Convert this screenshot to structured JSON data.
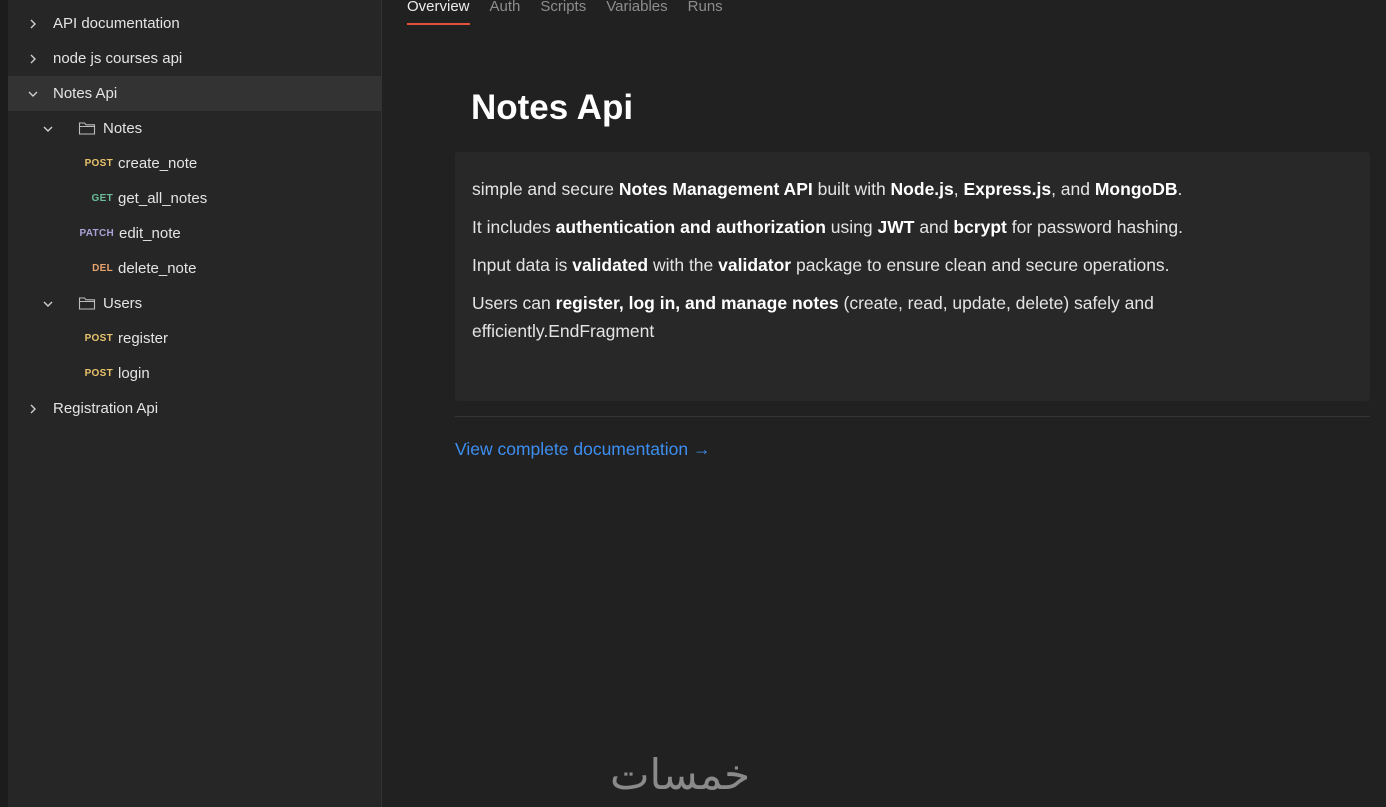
{
  "sidebar": {
    "collections": [
      {
        "label": "API documentation",
        "expanded": false
      },
      {
        "label": "node js courses api",
        "expanded": false
      },
      {
        "label": "Notes Api",
        "expanded": true,
        "selected": true
      },
      {
        "label": "Registration Api",
        "expanded": false
      }
    ],
    "folders": [
      {
        "label": "Notes",
        "requests": [
          {
            "method": "POST",
            "name": "create_note"
          },
          {
            "method": "GET",
            "name": "get_all_notes"
          },
          {
            "method": "PATCH",
            "name": "edit_note"
          },
          {
            "method": "DEL",
            "name": "delete_note"
          }
        ]
      },
      {
        "label": "Users",
        "requests": [
          {
            "method": "POST",
            "name": "register"
          },
          {
            "method": "POST",
            "name": "login"
          }
        ]
      }
    ]
  },
  "tabs": [
    {
      "label": "Overview",
      "active": true
    },
    {
      "label": "Auth"
    },
    {
      "label": "Scripts"
    },
    {
      "label": "Variables"
    },
    {
      "label": "Runs"
    }
  ],
  "overview": {
    "title": "Notes Api",
    "desc": {
      "l1": {
        "t1": "simple and secure ",
        "b1": "Notes Management API",
        "t2": " built with ",
        "b2": "Node.js",
        "t3": ", ",
        "b3": "Express.js",
        "t4": ", and ",
        "b4": "MongoDB",
        "t5": "."
      },
      "l2": {
        "t1": "It includes ",
        "b1": "authentication and authorization",
        "t2": " using ",
        "b2": "JWT",
        "t3": " and ",
        "b3": "bcrypt",
        "t4": " for password hashing."
      },
      "l3": {
        "t1": "Input data is ",
        "b1": "validated",
        "t2": " with the ",
        "b2": "validator",
        "t3": " package to ensure clean and secure operations."
      },
      "l4": {
        "t1": "Users can ",
        "b1": "register, log in, and manage notes",
        "t2": " (create, read, update, delete) safely and"
      },
      "l5": {
        "t1": "efficiently.EndFragment"
      }
    },
    "doc_link": "View complete documentation →"
  },
  "watermark": "خمسات",
  "colors": {
    "accent": "#e0533a",
    "link": "#3d8ef0",
    "post": "#e8c36b",
    "get": "#6bbd9a",
    "patch": "#a9a3d6",
    "del": "#e8a36b"
  }
}
